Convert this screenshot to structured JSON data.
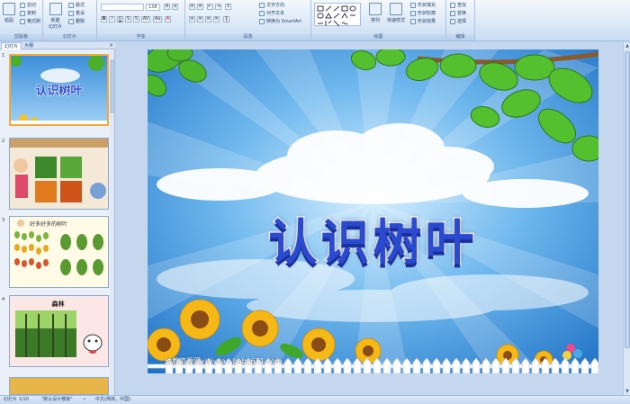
{
  "ribbon": {
    "clipboard": {
      "paste": "粘贴",
      "cut": "剪切",
      "copy": "复制",
      "format_painter": "格式刷",
      "label": "剪贴板"
    },
    "slides": {
      "new_slide": "新建\n幻灯片",
      "layout": "版式",
      "reset": "重设",
      "delete": "删除",
      "label": "幻灯片"
    },
    "font": {
      "font_name": "",
      "font_size": "138",
      "bold": "B",
      "italic": "I",
      "underline": "U",
      "strike": "S",
      "shadow": "S",
      "spacing": "AV",
      "case": "Aa",
      "color": "A",
      "label": "字体"
    },
    "paragraph": {
      "text_direction": "文字方向",
      "align_text": "对齐文本",
      "smartart": "转换为 SmartArt",
      "label": "段落"
    },
    "drawing": {
      "arrange": "排列",
      "quick_styles": "快速样式",
      "shape_fill": "形状填充",
      "shape_outline": "形状轮廓",
      "shape_effects": "形状效果",
      "label": "绘图"
    },
    "editing": {
      "find": "查找",
      "replace": "替换",
      "select": "选择",
      "label": "编辑"
    }
  },
  "pane": {
    "tabs": [
      "幻灯片",
      "大纲"
    ],
    "close": "×",
    "thumbs": [
      {
        "num": "1",
        "title": "认识树叶"
      },
      {
        "num": "2",
        "title": ""
      },
      {
        "num": "3",
        "title": "好多好多的树叶"
      },
      {
        "num": "4",
        "title": "森林"
      }
    ]
  },
  "slide": {
    "title": "认识树叶",
    "watermark_url": "幼教资源网yiziyuan.baby611.com",
    "watermark_sub": "PPT课件 · FLASH课件 · 教案 · 说课 · 试卷"
  },
  "status": {
    "slide_count": "幻灯片 1/10",
    "theme": "\"默认设计模板\"",
    "language": "中文(简体，中国)"
  },
  "colors": {
    "ribbon_bg": "#dbe8f7",
    "sky": "#3b8fd9",
    "title_fill": "#2a4bd0",
    "thumb_selected_border": "#f4a93a"
  }
}
